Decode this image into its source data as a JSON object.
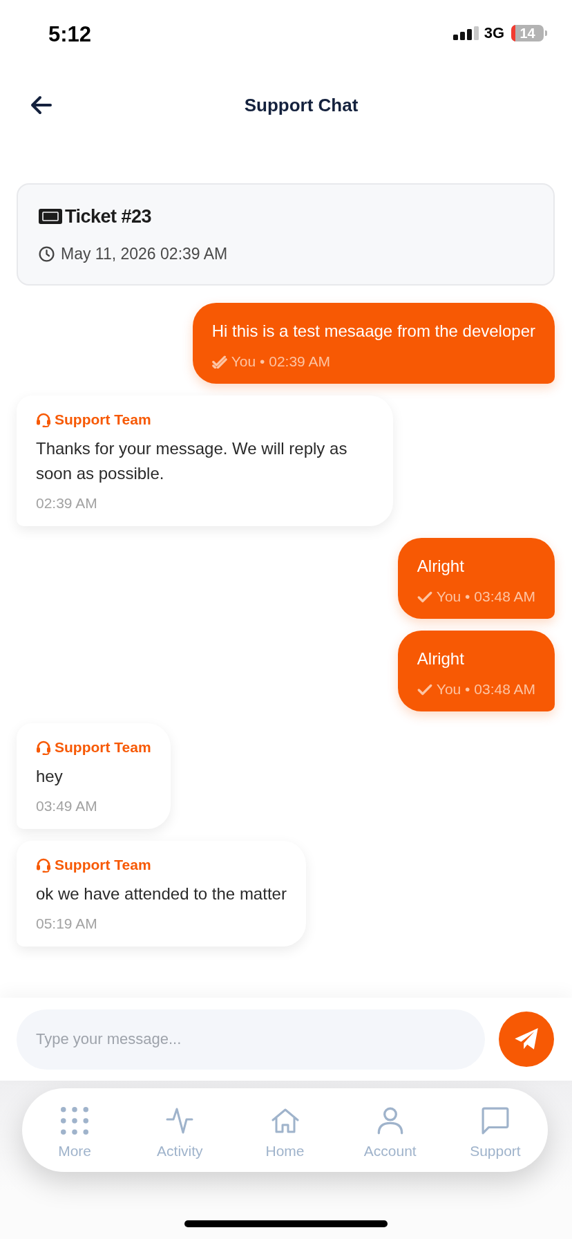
{
  "status_bar": {
    "time": "5:12",
    "network": "3G",
    "battery": "14"
  },
  "header": {
    "title": "Support Chat"
  },
  "ticket": {
    "title": "Ticket #23",
    "date": "May 11, 2026 02:39 AM"
  },
  "messages": [
    {
      "kind": "outgoing",
      "text": "Hi this is a test mesaage from the developer",
      "meta": "You • 02:39 AM",
      "read": true
    },
    {
      "kind": "incoming",
      "sender": "Support Team",
      "text": "Thanks for your message. We will reply as soon as possible.",
      "time": "02:39 AM"
    },
    {
      "kind": "outgoing",
      "text": "Alright",
      "meta": "You • 03:48 AM",
      "read": false
    },
    {
      "kind": "outgoing",
      "text": "Alright",
      "meta": "You • 03:48 AM",
      "read": false
    },
    {
      "kind": "incoming",
      "sender": "Support Team",
      "text": "hey",
      "time": "03:49 AM"
    },
    {
      "kind": "incoming",
      "sender": "Support Team",
      "text": "ok we have attended to the matter",
      "time": "05:19 AM"
    }
  ],
  "composer": {
    "placeholder": "Type your message..."
  },
  "nav": {
    "items": [
      {
        "label": "More",
        "selected": false
      },
      {
        "label": "Activity",
        "selected": false
      },
      {
        "label": "Home",
        "selected": false
      },
      {
        "label": "Account",
        "selected": false
      },
      {
        "label": "Support",
        "selected": false
      }
    ]
  }
}
